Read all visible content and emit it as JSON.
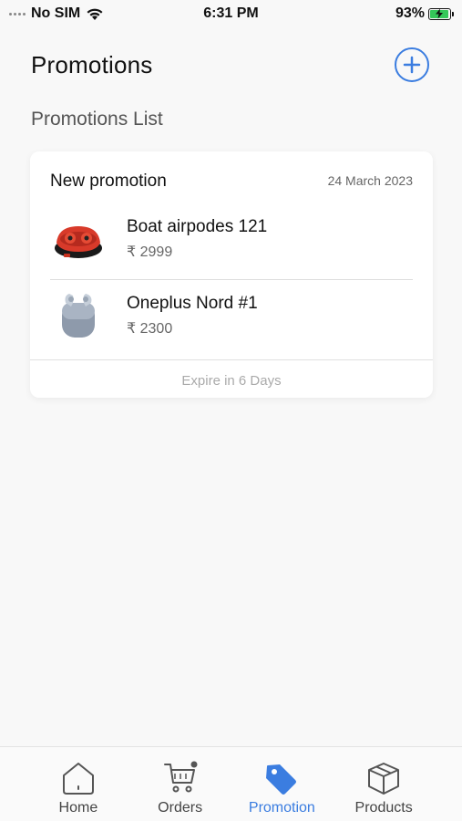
{
  "status_bar": {
    "carrier": "No SIM",
    "time": "6:31 PM",
    "battery": "93%",
    "battery_level": 0.93
  },
  "header": {
    "title": "Promotions",
    "add_icon": "plus-circle-icon"
  },
  "section_title": "Promotions List",
  "promotion": {
    "name": "New promotion",
    "date": "24 March 2023",
    "products": [
      {
        "name": "Boat airpodes 121",
        "price": "₹ 2999",
        "image": "red-earbuds"
      },
      {
        "name": "Oneplus Nord #1",
        "price": "₹ 2300",
        "image": "grey-earbuds"
      }
    ],
    "expire": "Expire in 6 Days"
  },
  "tabs": [
    {
      "label": "Home",
      "icon": "home-icon",
      "active": false
    },
    {
      "label": "Orders",
      "icon": "cart-icon",
      "active": false
    },
    {
      "label": "Promotion",
      "icon": "tag-icon",
      "active": true
    },
    {
      "label": "Products",
      "icon": "box-icon",
      "active": false
    }
  ],
  "colors": {
    "accent": "#3b7de0",
    "battery_green": "#34c759"
  }
}
